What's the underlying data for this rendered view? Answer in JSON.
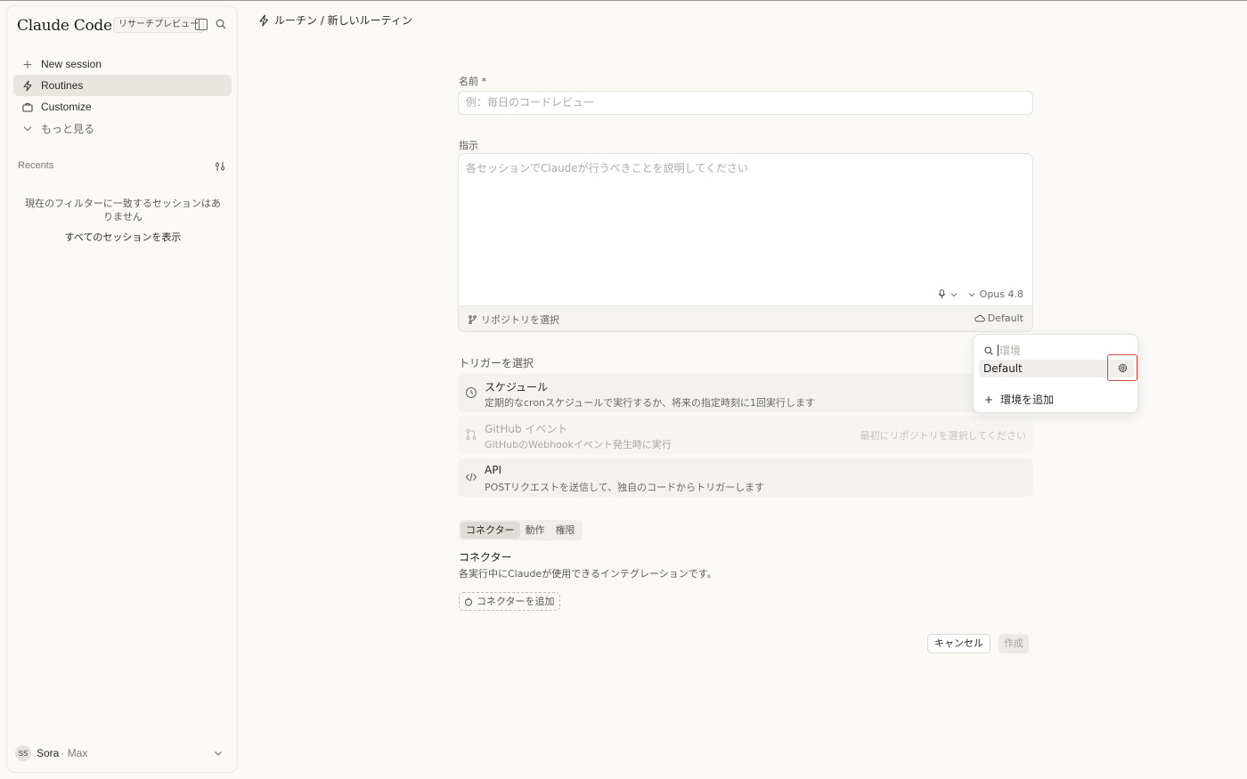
{
  "sidebar": {
    "brand": "Claude Code",
    "badge": "リサーチプレビュー",
    "nav": {
      "new_session": "New session",
      "routines": "Routines",
      "customize": "Customize",
      "more": "もっと見る"
    },
    "recents_label": "Recents",
    "empty_message": "現在のフィルターに一致するセッションはありません",
    "show_all": "すべてのセッションを表示",
    "user": {
      "initials": "SS",
      "name": "Sora",
      "plan": "· Max"
    }
  },
  "breadcrumb": {
    "text": "ルーチン / 新しいルーティン"
  },
  "form": {
    "name_label": "名前 *",
    "name_placeholder": "例：毎日のコードレビュー",
    "instructions_label": "指示",
    "instructions_placeholder": "各セッションでClaudeが行うべきことを説明してください",
    "model": "Opus 4.8",
    "repo_select": "リポジトリを選択",
    "environment": "Default",
    "trigger_label": "トリガーを選択",
    "triggers": [
      {
        "title": "スケジュール",
        "desc": "定期的なcronスケジュールで実行するか、将来の指定時刻に1回実行します",
        "note": ""
      },
      {
        "title": "GitHub イベント",
        "desc": "GitHubのWebhookイベント発生時に実行",
        "note": "最初にリポジトリを選択してください"
      },
      {
        "title": "API",
        "desc": "POSTリクエストを送信して、独自のコードからトリガーします",
        "note": ""
      }
    ],
    "tabs": [
      "コネクター",
      "動作",
      "権限"
    ],
    "section_title": "コネクター",
    "section_desc": "各実行中にClaudeが使用できるインテグレーションです。",
    "add_connector": "コネクターを追加",
    "cancel": "キャンセル",
    "create": "作成"
  },
  "env_popup": {
    "search_placeholder": "環境",
    "items": [
      "Default"
    ],
    "add_env": "環境を追加"
  },
  "colors": {
    "highlight": "#d9473a",
    "background": "#faf9f6"
  }
}
